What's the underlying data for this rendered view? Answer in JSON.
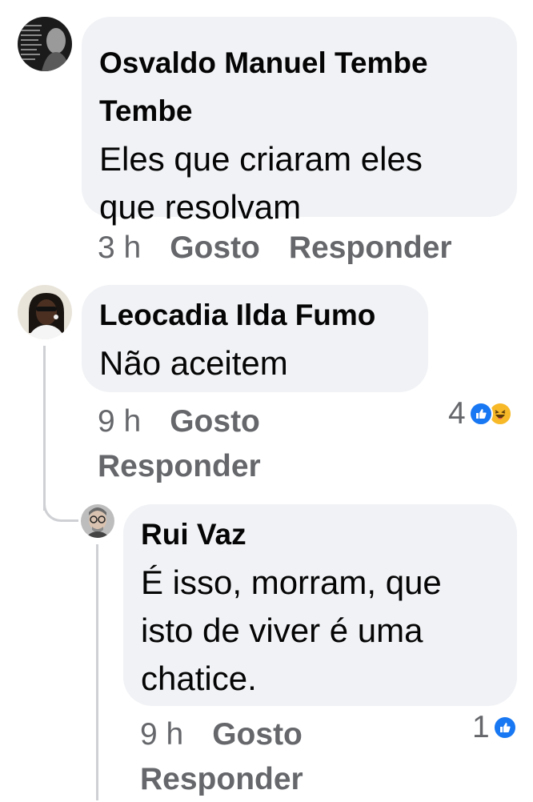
{
  "comments": [
    {
      "author": "Osvaldo Manuel Tembe Tembe",
      "author_lines": [
        "Osvaldo Manuel Tembe",
        "Tembe"
      ],
      "text_lines": [
        "Eles que criaram eles",
        "que resolvam"
      ],
      "time": "3 h",
      "like_label": "Gosto",
      "reply_label": "Responder"
    },
    {
      "author": "Leocadia Ilda Fumo",
      "text_lines": [
        "Não aceitem"
      ],
      "time": "9 h",
      "like_label": "Gosto",
      "reply_label": "Responder",
      "reaction_count": "4",
      "reactions": [
        "like-icon",
        "haha-icon"
      ]
    },
    {
      "author": "Rui Vaz",
      "text_lines": [
        "É isso, morram, que",
        "isto de viver é uma",
        "chatice."
      ],
      "time": "9 h",
      "like_label": "Gosto",
      "reply_label": "Responder",
      "reaction_count": "1",
      "reactions": [
        "like-icon"
      ]
    }
  ],
  "colors": {
    "bubble": "#f0f2f5",
    "meta_text": "#65676b",
    "like_blue": "#1877f2",
    "haha_yellow": "#f7b928",
    "thread_line": "#ced0d4"
  }
}
